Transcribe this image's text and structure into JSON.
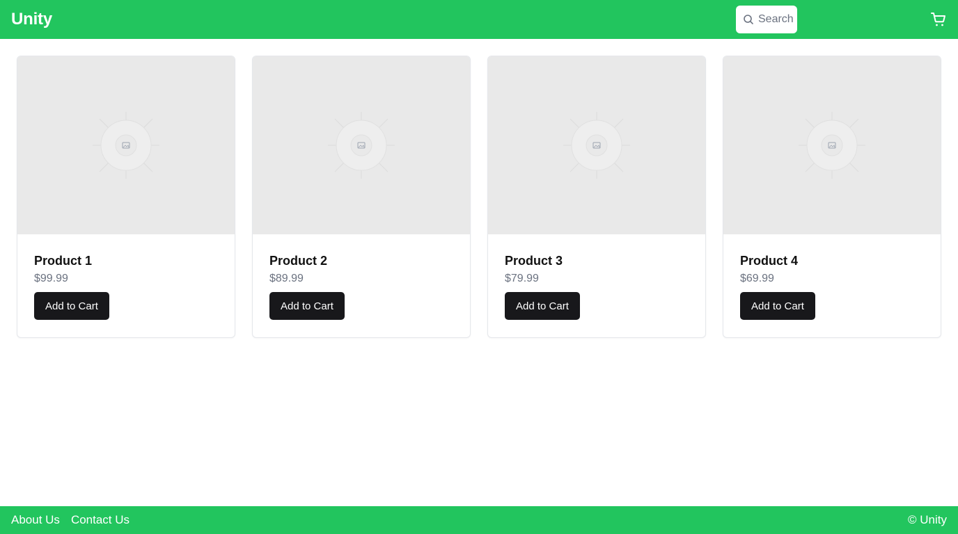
{
  "header": {
    "brand": "Unity",
    "search": {
      "placeholder": "Search",
      "value": ""
    },
    "cart_icon": "shopping-cart-icon",
    "search_icon": "search-icon"
  },
  "products": [
    {
      "name": "Product 1",
      "price": "$99.99",
      "button": "Add to Cart"
    },
    {
      "name": "Product 2",
      "price": "$89.99",
      "button": "Add to Cart"
    },
    {
      "name": "Product 3",
      "price": "$79.99",
      "button": "Add to Cart"
    },
    {
      "name": "Product 4",
      "price": "$69.99",
      "button": "Add to Cart"
    }
  ],
  "footer": {
    "links": [
      "About Us",
      "Contact Us"
    ],
    "copyright": "© Unity"
  },
  "colors": {
    "brand_green": "#22c55e",
    "button_dark": "#18181b",
    "price_gray": "#6b7280",
    "image_placeholder": "#e9e9e9"
  }
}
